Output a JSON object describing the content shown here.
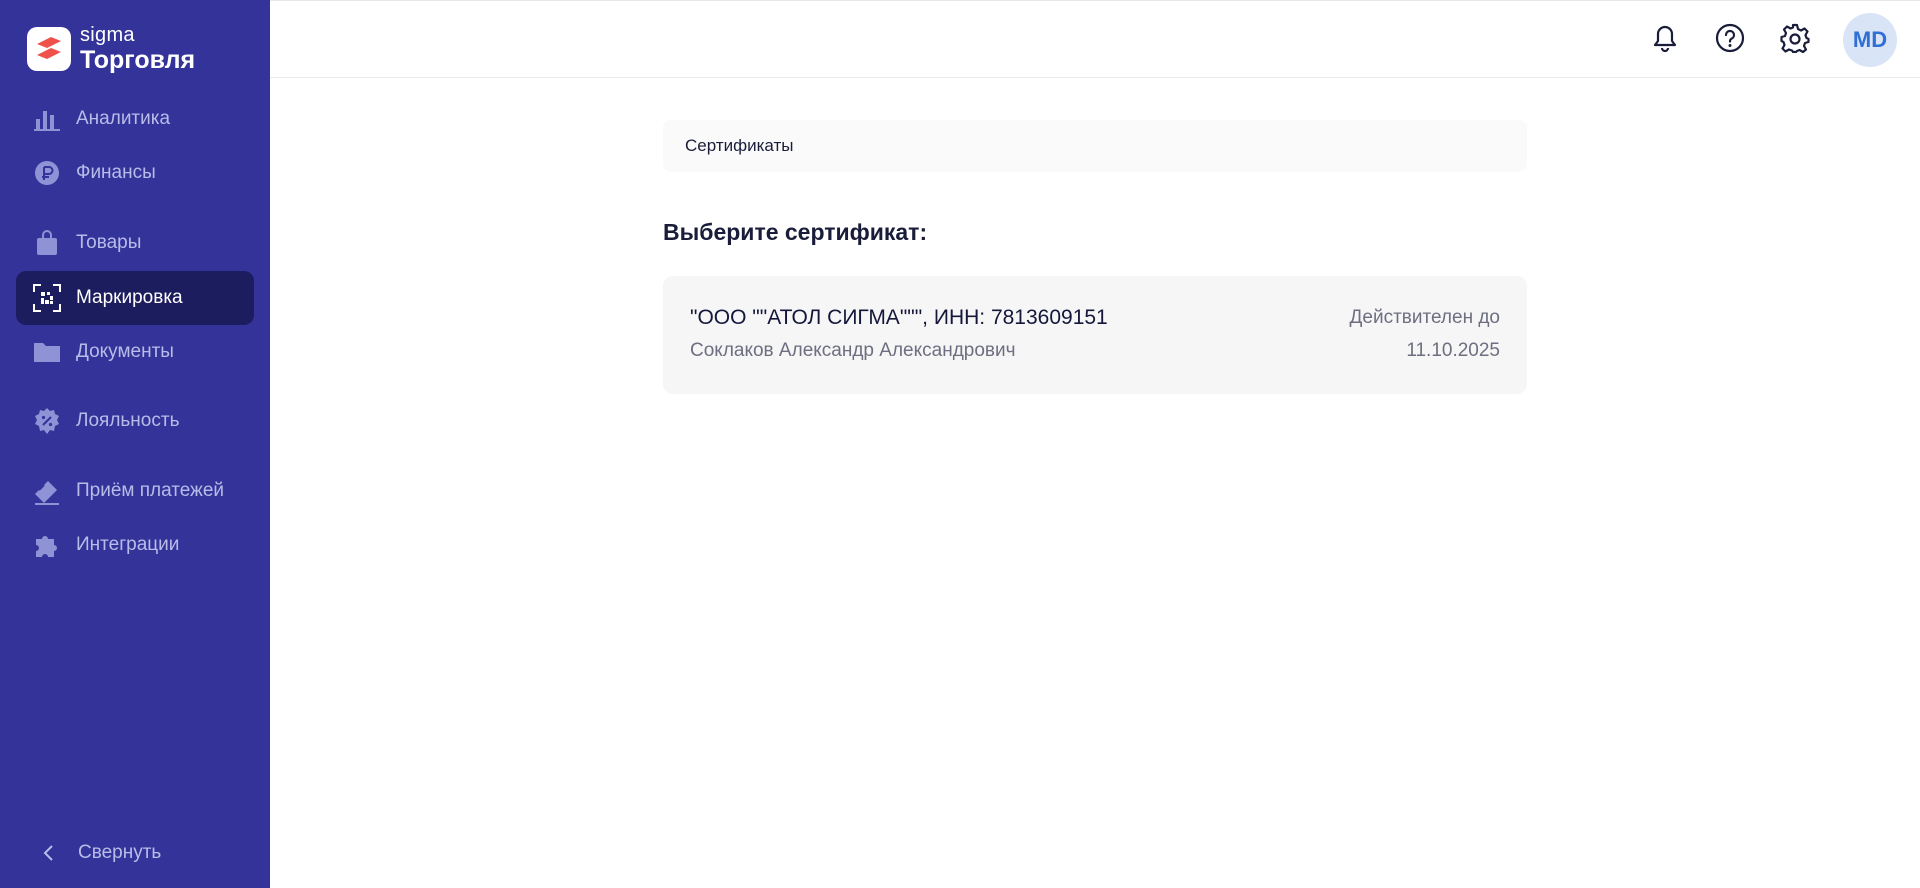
{
  "logo": {
    "brand": "sigma",
    "product": "Торговля",
    "colors": {
      "mark_red": "#f0514b",
      "mark_bg": "#ffffff"
    }
  },
  "sidebar": {
    "bg_color": "#333399",
    "active_color": "#1c1d5e",
    "items": [
      {
        "label": "Аналитика",
        "icon": "bar-chart-icon",
        "active": false
      },
      {
        "label": "Финансы",
        "icon": "ruble-icon",
        "active": false
      },
      {
        "label": "Товары",
        "icon": "shopping-bag-icon",
        "active": false
      },
      {
        "label": "Маркировка",
        "icon": "datamatrix-scan-icon",
        "active": true
      },
      {
        "label": "Документы",
        "icon": "folder-icon",
        "active": false
      },
      {
        "label": "Лояльность",
        "icon": "discount-badge-icon",
        "active": false
      },
      {
        "label": "Приём платежей",
        "icon": "payment-card-icon",
        "active": false
      },
      {
        "label": "Интеграции",
        "icon": "puzzle-icon",
        "active": false
      }
    ],
    "collapse_label": "Свернуть"
  },
  "header": {
    "icons": [
      "bell-icon",
      "help-icon",
      "gear-icon"
    ],
    "avatar_initials": "MD",
    "avatar_color": "#2f6fd6"
  },
  "main": {
    "breadcrumb": "Сертификаты",
    "title": "Выберите сертификат:",
    "certificates": [
      {
        "org": "\"ООО \"\"АТОЛ СИГМА\"\"\", ИНН: 7813609151",
        "owner": "Соклаков Александр Александрович",
        "valid_label": "Действителен до",
        "valid_date": "11.10.2025"
      }
    ]
  }
}
